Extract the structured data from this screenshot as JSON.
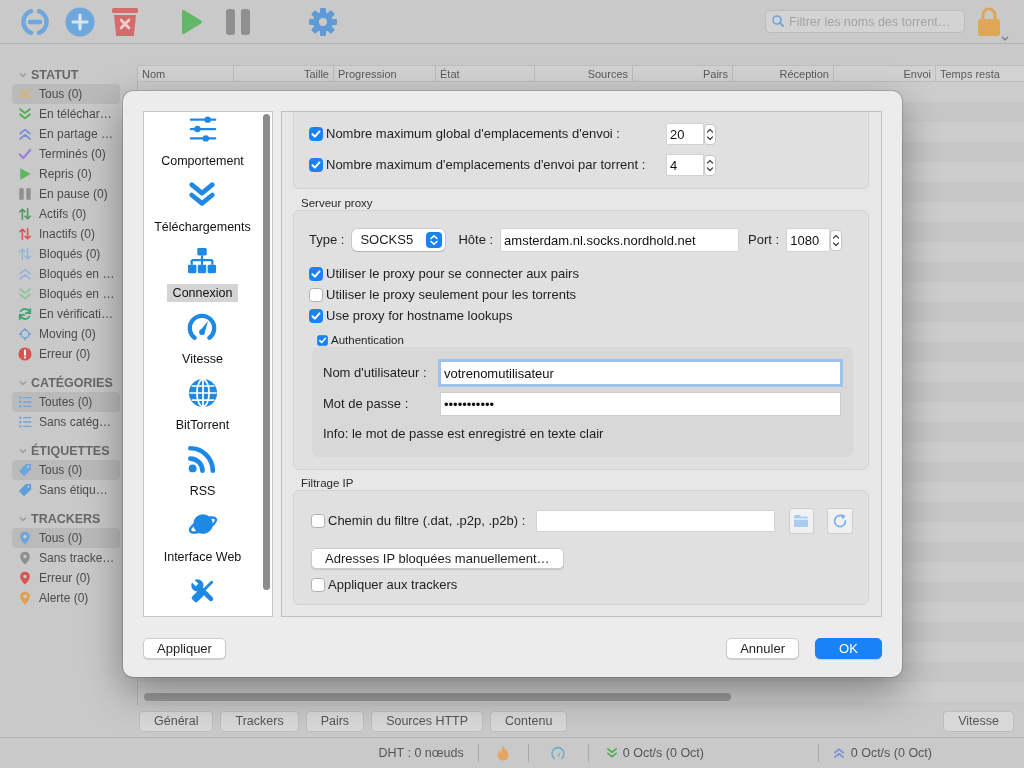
{
  "toolbar": {
    "search": {
      "placeholder": "Filtrer les noms des torrent…"
    }
  },
  "sidebar": {
    "sections": [
      {
        "title": "STATUT",
        "expanded": true,
        "items": [
          {
            "label": "Tous (0)",
            "selected": true
          },
          {
            "label": "En téléchar…",
            "selected": false
          },
          {
            "label": "En partage …",
            "selected": false
          },
          {
            "label": "Terminés (0)",
            "selected": false
          },
          {
            "label": "Repris (0)",
            "selected": false
          },
          {
            "label": "En pause (0)",
            "selected": false
          },
          {
            "label": "Actifs (0)",
            "selected": false
          },
          {
            "label": "Inactifs (0)",
            "selected": false
          },
          {
            "label": "Bloqués (0)",
            "selected": false
          },
          {
            "label": "Bloqués en …",
            "selected": false
          },
          {
            "label": "Bloqués en …",
            "selected": false
          },
          {
            "label": "En vérificati…",
            "selected": false
          },
          {
            "label": "Moving (0)",
            "selected": false
          },
          {
            "label": "Erreur (0)",
            "selected": false
          }
        ]
      },
      {
        "title": "CATÉGORIES",
        "expanded": true,
        "items": [
          {
            "label": "Toutes (0)",
            "selected": true
          },
          {
            "label": "Sans catég…",
            "selected": false
          }
        ]
      },
      {
        "title": "ÉTIQUETTES",
        "expanded": true,
        "items": [
          {
            "label": "Tous (0)",
            "selected": true
          },
          {
            "label": "Sans étiqu…",
            "selected": false
          }
        ]
      },
      {
        "title": "TRACKERS",
        "expanded": true,
        "items": [
          {
            "label": "Tous (0)",
            "selected": true
          },
          {
            "label": "Sans tracke…",
            "selected": false
          },
          {
            "label": "Erreur (0)",
            "selected": false
          },
          {
            "label": "Alerte (0)",
            "selected": false
          }
        ]
      }
    ]
  },
  "table": {
    "columns": [
      "Nom",
      "Taille",
      "Progression",
      "État",
      "Sources",
      "Pairs",
      "Réception",
      "Envoi",
      "Temps resta"
    ]
  },
  "details_tabs": [
    {
      "label": "Général",
      "selected": false
    },
    {
      "label": "Trackers",
      "selected": false
    },
    {
      "label": "Pairs",
      "selected": false
    },
    {
      "label": "Sources HTTP",
      "selected": false
    },
    {
      "label": "Contenu",
      "selected": false
    }
  ],
  "speed_button": {
    "label": "Vitesse"
  },
  "status_bar": {
    "dht": "DHT : 0 nœuds",
    "download": "0 Oct/s (0 Oct)",
    "upload": "0 Oct/s (0 Oct)"
  },
  "dialog": {
    "nav": [
      {
        "label": "Comportement",
        "selected": false
      },
      {
        "label": "Téléchargements",
        "selected": false
      },
      {
        "label": "Connexion",
        "selected": true
      },
      {
        "label": "Vitesse",
        "selected": false
      },
      {
        "label": "BitTorrent",
        "selected": false
      },
      {
        "label": "RSS",
        "selected": false
      },
      {
        "label": "Interface Web",
        "selected": false
      },
      {
        "selected": false
      }
    ],
    "upload_slots": [
      {
        "label": "Nombre maximum global d'emplacements d'envoi :",
        "checked": true,
        "value": "20"
      },
      {
        "label": "Nombre maximum d'emplacements d'envoi par torrent :",
        "checked": true,
        "value": "4"
      }
    ],
    "proxy": {
      "title": "Serveur proxy",
      "type_label": "Type :",
      "type": "SOCKS5",
      "host_label": "Hôte :",
      "host": "amsterdam.nl.socks.nordhold.net",
      "port_label": "Port :",
      "port": "1080",
      "options": [
        {
          "label": "Utiliser le proxy pour se connecter aux pairs",
          "checked": true
        },
        {
          "label": "Utiliser le proxy seulement pour les torrents",
          "checked": false
        },
        {
          "label": "Use proxy for hostname lookups",
          "checked": true
        }
      ],
      "auth": {
        "label": "Authentication",
        "checked": true,
        "fields": [
          {
            "label": "Nom d'utilisateur :",
            "value": "votrenomutilisateur",
            "focused": true
          },
          {
            "label": "Mot de passe :",
            "value": "•••••••••••",
            "focused": false
          }
        ],
        "info": "Info: le mot de passe est enregistré en texte clair"
      }
    },
    "ip_filter": {
      "title": "Filtrage IP",
      "path": {
        "label": "Chemin du filtre (.dat, .p2p, .p2b) :",
        "checked": false
      },
      "manual_button": "Adresses IP bloquées manuellement…",
      "trackers": {
        "label": "Appliquer aux trackers",
        "checked": false
      }
    },
    "footer": {
      "left": [
        {
          "label": "Appliquer",
          "kind": "default"
        }
      ],
      "right": [
        {
          "label": "Annuler",
          "kind": "default"
        },
        {
          "label": "OK",
          "kind": "primary"
        }
      ]
    }
  }
}
